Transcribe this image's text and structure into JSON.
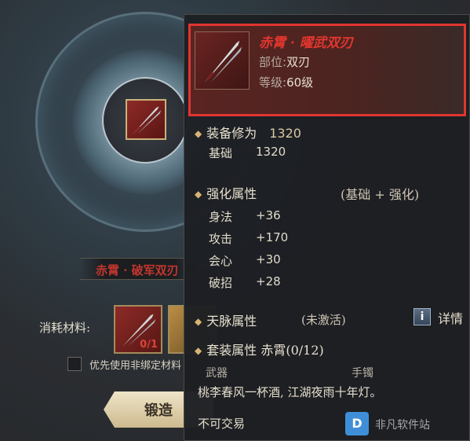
{
  "forge_panel": {
    "item_name": "赤霄 · 破军双刃",
    "materials_label": "消耗材料:",
    "material_count": "0/1",
    "checkbox_label": "优先使用非绑定材料",
    "forge_button": "锻造"
  },
  "tooltip": {
    "name": "赤霄 · 曜武双刃",
    "slot_key": "部位:",
    "slot_value": "双刃",
    "level_key": "等级:",
    "level_value": "60级",
    "cultivation": {
      "label": "装备修为",
      "value": "1320"
    },
    "base": {
      "label": "基础",
      "value": "1320"
    },
    "enhance": {
      "label": "强化属性",
      "note": "(基础 + 强化)"
    },
    "stats": [
      {
        "name": "身法",
        "value": "+36"
      },
      {
        "name": "攻击",
        "value": "+170"
      },
      {
        "name": "会心",
        "value": "+30"
      },
      {
        "name": "破招",
        "value": "+28"
      }
    ],
    "meridian": {
      "label": "天脉属性",
      "status": "(未激活)"
    },
    "details_label": "详情",
    "set": {
      "label": "套装属性 赤霄(0/12)",
      "pieces": [
        "武器",
        "手镯"
      ]
    },
    "flavor_text": "桃李春风一杯酒, 江湖夜雨十年灯。",
    "tradeable": "不可交易"
  },
  "watermark": {
    "logo": "D",
    "text": "非凡软件站"
  },
  "colors": {
    "highlight_border": "#e03530",
    "item_name": "#e2362f",
    "accent": "#d6b472"
  }
}
